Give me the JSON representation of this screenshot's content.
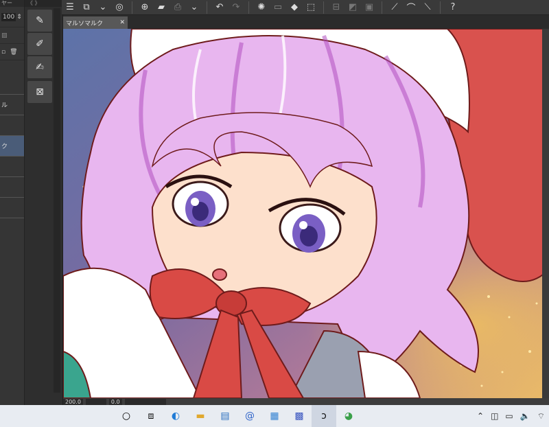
{
  "left_panel": {
    "header": "ヤー",
    "opacity_value": "100",
    "items": [
      {
        "label": ""
      },
      {
        "label": "ル"
      },
      {
        "label": ""
      },
      {
        "label": "ク",
        "selected": true
      },
      {
        "label": ""
      },
      {
        "label": ""
      },
      {
        "label": ""
      }
    ]
  },
  "tool_column": {
    "header": "《  》"
  },
  "document": {
    "tab_title": "マルソマルク",
    "close_label": "✕"
  },
  "status": {
    "zoom": "200.0",
    "rotation": "0.0"
  },
  "colors": {
    "accent": "#4a5c78",
    "hat_red": "#d9524e",
    "hair_pink": "#e8b6ef",
    "bow_red": "#d94a45"
  },
  "toolbar_icons": [
    "menu-icon",
    "new-canvas-icon",
    "open-folder-icon",
    "save-icon",
    "undo-icon",
    "redo-icon",
    "loading-icon",
    "fill-icon",
    "transform-icon",
    "ruler-icon",
    "help-icon"
  ],
  "taskbar_icons": [
    "start-icon",
    "task-view-icon",
    "edge-icon",
    "explorer-icon",
    "store-icon",
    "mail-icon",
    "news-icon",
    "calendar-icon",
    "clip-studio-icon",
    "paint-icon"
  ]
}
